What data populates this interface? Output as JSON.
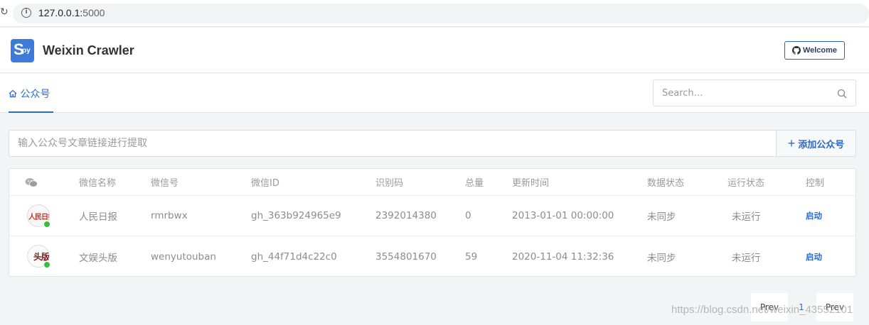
{
  "browser": {
    "url_host": "127.0.0.1:",
    "url_port": "5000"
  },
  "header": {
    "logo_main": "S",
    "logo_sub": "py",
    "title": "Weixin Crawler",
    "welcome_label": "Welcome"
  },
  "tabs": [
    {
      "label": "公众号",
      "icon": "home-icon",
      "active": true
    }
  ],
  "search": {
    "placeholder": "Search…"
  },
  "link_input": {
    "placeholder": "输入公众号文章链接进行提取",
    "value": ""
  },
  "add_button": {
    "icon": "plus-icon",
    "label": "添加公众号"
  },
  "table": {
    "headers": [
      "微信名称",
      "微信号",
      "微信ID",
      "识别码",
      "总量",
      "更新时间",
      "数据状态",
      "运行状态",
      "控制"
    ],
    "rows": [
      {
        "avatar_text": "人民日报",
        "online": true,
        "name": "人民日报",
        "account": "rmrbwx",
        "wx_id": "gh_363b924965e9",
        "code": "2392014380",
        "total": "0",
        "updated": "2013-01-01 00:00:00",
        "data_status": "未同步",
        "run_status": "未运行",
        "action": "启动"
      },
      {
        "avatar_text": "头版",
        "online": true,
        "name": "文娱头版",
        "account": "wenyutouban",
        "wx_id": "gh_44f71d4c22c0",
        "code": "3554801670",
        "total": "59",
        "updated": "2020-11-04 11:32:36",
        "data_status": "未同步",
        "run_status": "未运行",
        "action": "启动"
      }
    ]
  },
  "pagination": {
    "prev_label": "Prev",
    "current_page": "1",
    "next_label": "Prev"
  },
  "watermark": "https://blog.csdn.net/weixin_43552101",
  "colors": {
    "accent": "#2e6bc4",
    "online": "#3cbc3c",
    "logo_bg": "#3e7ad8"
  }
}
